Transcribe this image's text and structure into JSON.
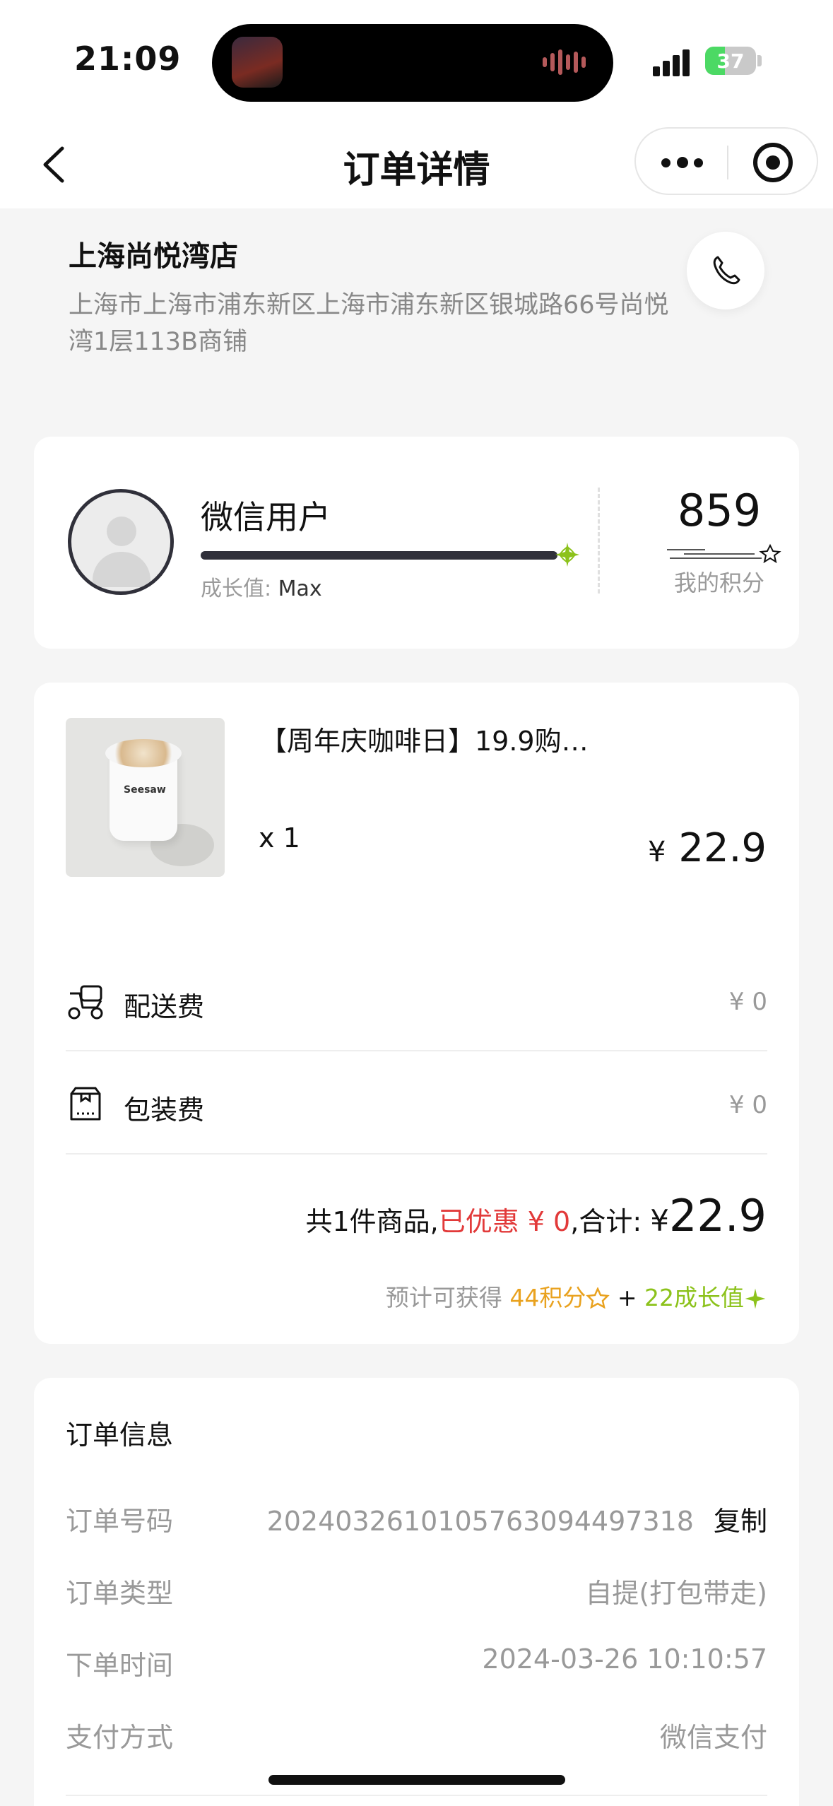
{
  "status_bar": {
    "time": "21:09",
    "battery": "37"
  },
  "nav": {
    "title": "订单详情"
  },
  "store": {
    "name": "上海尚悦湾店",
    "address": "上海市上海市浦东新区上海市浦东新区银城路66号尚悦湾1层113B商铺"
  },
  "member": {
    "name": "微信用户",
    "growth_label": "成长值:",
    "growth_value": "Max",
    "points": "859",
    "points_label": "我的积分"
  },
  "order": {
    "product_name": "【周年庆咖啡日】19.9购…",
    "product_qty": "x 1",
    "product_price_symbol": "¥",
    "product_price": "22.9",
    "fees": [
      {
        "label": "配送费",
        "value": "¥ 0",
        "icon": "delivery-scooter-icon"
      },
      {
        "label": "包装费",
        "value": "¥ 0",
        "icon": "package-bag-icon"
      }
    ],
    "summary": {
      "count_text": "共1件商品,",
      "discount_text": "已优惠 ¥ 0",
      "total_label": ",合计:",
      "total_symbol": "¥",
      "total_value": "22.9"
    },
    "earn": {
      "prefix": "预计可获得",
      "points": "44积分",
      "plus": "+",
      "growth": "22成长值"
    }
  },
  "info": {
    "title": "订单信息",
    "rows": [
      {
        "label": "订单号码",
        "value": "20240326101057630944973​18",
        "action": "复制"
      },
      {
        "label": "订单类型",
        "value": "自提(打包带走)"
      },
      {
        "label": "下单时间",
        "value": "2024-03-26 10:10:57"
      },
      {
        "label": "支付方式",
        "value": "微信支付"
      }
    ]
  },
  "colors": {
    "accent_red": "#e23a3a",
    "points_orange": "#e9a21f",
    "growth_green": "#8cc21b"
  }
}
